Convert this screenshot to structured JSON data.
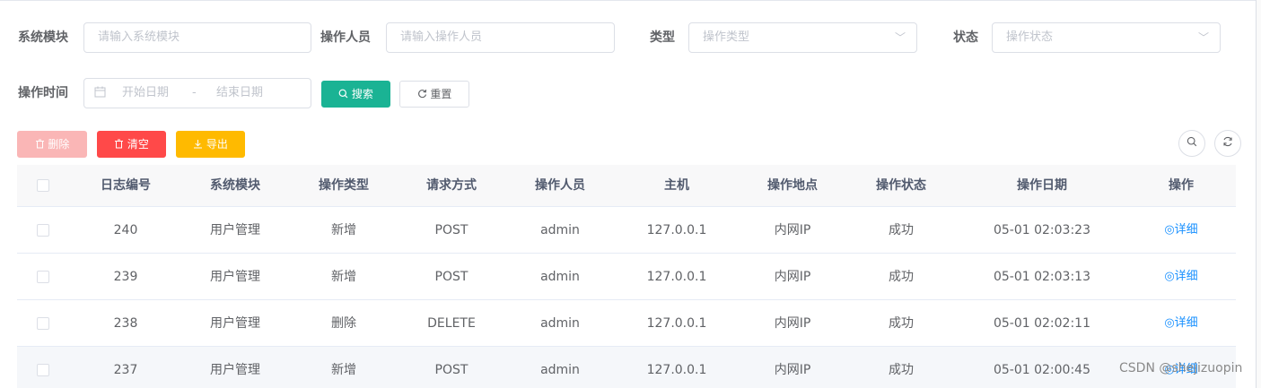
{
  "search_form": {
    "module": {
      "label": "系统模块",
      "placeholder": "请输入系统模块"
    },
    "operator": {
      "label": "操作人员",
      "placeholder": "请输入操作人员"
    },
    "type": {
      "label": "类型",
      "placeholder": "操作类型"
    },
    "status": {
      "label": "状态",
      "placeholder": "操作状态"
    },
    "time": {
      "label": "操作时间",
      "start_placeholder": "开始日期",
      "separator": "-",
      "end_placeholder": "结束日期"
    },
    "search_label": "搜索",
    "reset_label": "重置"
  },
  "toolbar": {
    "delete_label": "删除",
    "clear_label": "清空",
    "export_label": "导出"
  },
  "icons": {
    "search": "search-icon",
    "refresh": "refresh-icon",
    "calendar": "calendar-icon",
    "delete": "trash-icon",
    "export": "download-icon",
    "detail": "eye-icon",
    "select_arrow": "chevron-down-icon"
  },
  "colors": {
    "primary": "#1ab394",
    "danger": "#ff4949",
    "danger_light": "#fab6b6",
    "warning": "#ffba00",
    "link": "#1890ff"
  },
  "table": {
    "columns": [
      "日志编号",
      "系统模块",
      "操作类型",
      "请求方式",
      "操作人员",
      "主机",
      "操作地点",
      "操作状态",
      "操作日期",
      "操作"
    ],
    "rows": [
      {
        "id": "240",
        "module": "用户管理",
        "type": "新增",
        "method": "POST",
        "operator": "admin",
        "host": "127.0.0.1",
        "location": "内网IP",
        "status": "成功",
        "date": "05-01 02:03:23",
        "action": "详细"
      },
      {
        "id": "239",
        "module": "用户管理",
        "type": "新增",
        "method": "POST",
        "operator": "admin",
        "host": "127.0.0.1",
        "location": "内网IP",
        "status": "成功",
        "date": "05-01 02:03:13",
        "action": "详细"
      },
      {
        "id": "238",
        "module": "用户管理",
        "type": "删除",
        "method": "DELETE",
        "operator": "admin",
        "host": "127.0.0.1",
        "location": "内网IP",
        "status": "成功",
        "date": "05-01 02:02:11",
        "action": "详细"
      },
      {
        "id": "237",
        "module": "用户管理",
        "type": "新增",
        "method": "POST",
        "operator": "admin",
        "host": "127.0.0.1",
        "location": "内网IP",
        "status": "成功",
        "date": "05-01 02:00:45",
        "action": "详细"
      }
    ]
  },
  "watermark": "CSDN @shejizuopin"
}
